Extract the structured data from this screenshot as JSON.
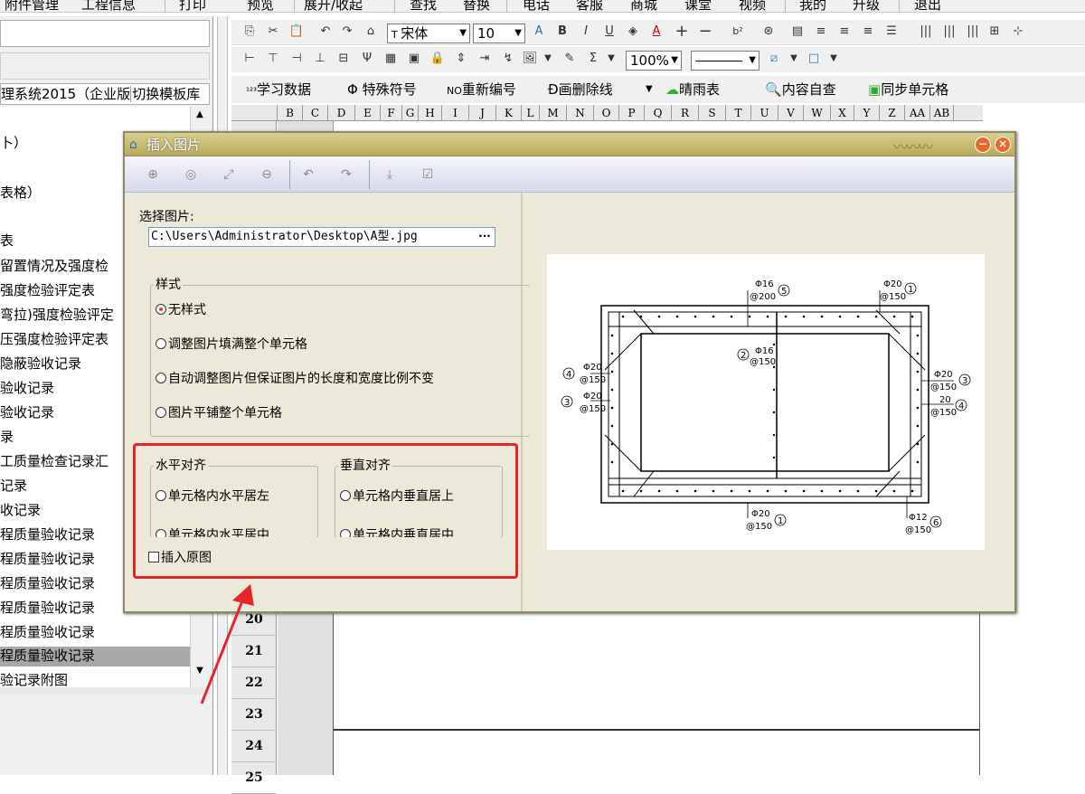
{
  "menubar": {
    "items": [
      "附件管理",
      "工程信息",
      "打印",
      "预览",
      "展开/收起",
      "查找",
      "替换",
      "电话",
      "客服",
      "商城",
      "课堂",
      "视频",
      "我的",
      "升级",
      "退出"
    ]
  },
  "left_panel": {
    "title": "理系统2015（企业版",
    "switch_label": "切换模板库",
    "tree_items": [
      "卜）",
      "表格）",
      "表",
      "留置情况及强度检",
      "强度检验评定表",
      "弯拉)强度检验评定",
      "压强度检验评定表",
      "隐蔽验收记录",
      "验收记录",
      "验收记录",
      "录",
      "工质量检查记录汇",
      "记录",
      "收记录",
      "程质量验收记录",
      "程质量验收记录",
      "程质量验收记录",
      "程质量验收记录",
      "程质量验收记录",
      "程质量验收记录",
      "验记录附图"
    ],
    "selected_index": 19
  },
  "toolbar": {
    "font_name": "宋体",
    "font_size": "10",
    "zoom": "100%",
    "tb3": [
      "学习数据",
      "特殊符号",
      "重新编号",
      "画删除线",
      "晴雨表",
      "内容自查",
      "同步单元格"
    ],
    "tb3_prefix": [
      "¹²³",
      "Φ",
      "NO",
      "Ð",
      "",
      "",
      ""
    ]
  },
  "sheet": {
    "columns": [
      "B",
      "C",
      "D",
      "E",
      "F",
      "G",
      "H",
      "I",
      "J",
      "K",
      "L",
      "M",
      "N",
      "O",
      "P",
      "Q",
      "R",
      "S",
      "T",
      "U",
      "V",
      "W",
      "X",
      "Y",
      "Z",
      "AA",
      "AB"
    ],
    "rows": [
      "20",
      "21",
      "22",
      "23",
      "24",
      "25"
    ]
  },
  "dialog": {
    "title": "插入图片",
    "select_label": "选择图片:",
    "path_value": "C:\\Users\\Administrator\\Desktop\\A型.jpg",
    "browse_label": "···",
    "style_group": "样式",
    "style_options": [
      "无样式",
      "调整图片填满整个单元格",
      "自动调整图片但保证图片的长度和宽度比例不变",
      "图片平铺整个单元格"
    ],
    "style_selected": 0,
    "halign_group": "水平对齐",
    "halign_options": [
      "单元格内水平居左",
      "单元格内水平居中"
    ],
    "valign_group": "垂直对齐",
    "valign_options": [
      "单元格内垂直居上",
      "单元格内垂直居中"
    ],
    "insert_original": "插入原图",
    "preview": {
      "labels": [
        "Φ16",
        "@200",
        "5",
        "Φ20",
        "@150",
        "1",
        "Φ16",
        "@150",
        "2",
        "Φ20",
        "@150",
        "4",
        "Φ20",
        "@150",
        "3",
        "Φ20",
        "@150",
        "3",
        "20",
        "@150",
        "4",
        "Φ20",
        "@150",
        "1",
        "Φ12",
        "@150",
        "6"
      ]
    }
  },
  "colors": {
    "accent": "#e5252a",
    "title_bar": "#c8bb72",
    "dialog_bg": "#ece9d8"
  }
}
